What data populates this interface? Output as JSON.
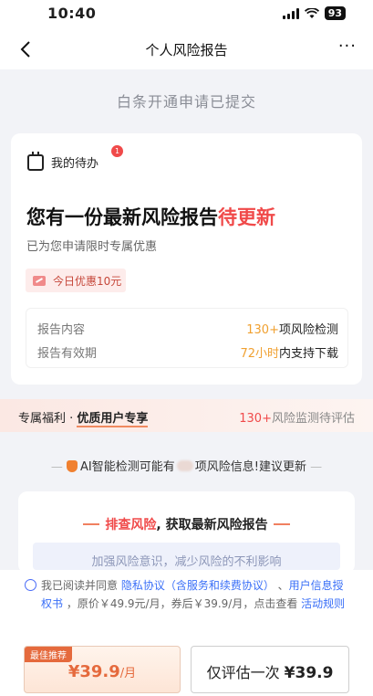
{
  "status_bar": {
    "time": "10:40",
    "battery": "93"
  },
  "nav": {
    "title": "个人风险报告",
    "more": "···"
  },
  "banner": {
    "text": "白条开通申请已提交"
  },
  "todo": {
    "label": "我的待办",
    "badge": "1"
  },
  "headline": {
    "main": "您有一份最新风险报告",
    "accent": "待更新"
  },
  "subline": "已为您申请限时专属优惠",
  "coupon": {
    "text": "今日优惠10元"
  },
  "info": {
    "rows": [
      {
        "key": "报告内容",
        "highlight": "130+",
        "rest": "项风险检测"
      },
      {
        "key": "报告有效期",
        "highlight": "72小时",
        "rest": "内支持下载"
      }
    ]
  },
  "perk": {
    "prefix": "专属福利 · ",
    "bold": "优质用户专享",
    "count": "130+",
    "rest": "风险监测待评估"
  },
  "ai_notice": {
    "dash_left": "—",
    "before": "AI智能检测可能有",
    "after": "项风险信息!建议更新",
    "dash_right": "—"
  },
  "check": {
    "hl": "排查风险",
    "rest": ", 获取最新风险报告",
    "strip": "加强风险意识，减少风险的不利影响"
  },
  "agreement": {
    "p1": "我已阅读并同意 ",
    "link1": "隐私协议（含服务和续费协议）",
    "p2": " 、",
    "link2": "用户信息授权书",
    "p3": " ，原价￥49.9元/月，券后￥39.9/月，点击查看 ",
    "link3": "活动规则"
  },
  "buttons": {
    "primary_badge": "最佳推荐",
    "primary_price": "¥39.9",
    "primary_unit": "/月",
    "secondary_label": "仅评估一次 ",
    "secondary_price": "¥39.9"
  },
  "colors": {
    "accent_red": "#f04a4a",
    "accent_orange": "#e56a3d",
    "link_blue": "#3a6ff7"
  }
}
